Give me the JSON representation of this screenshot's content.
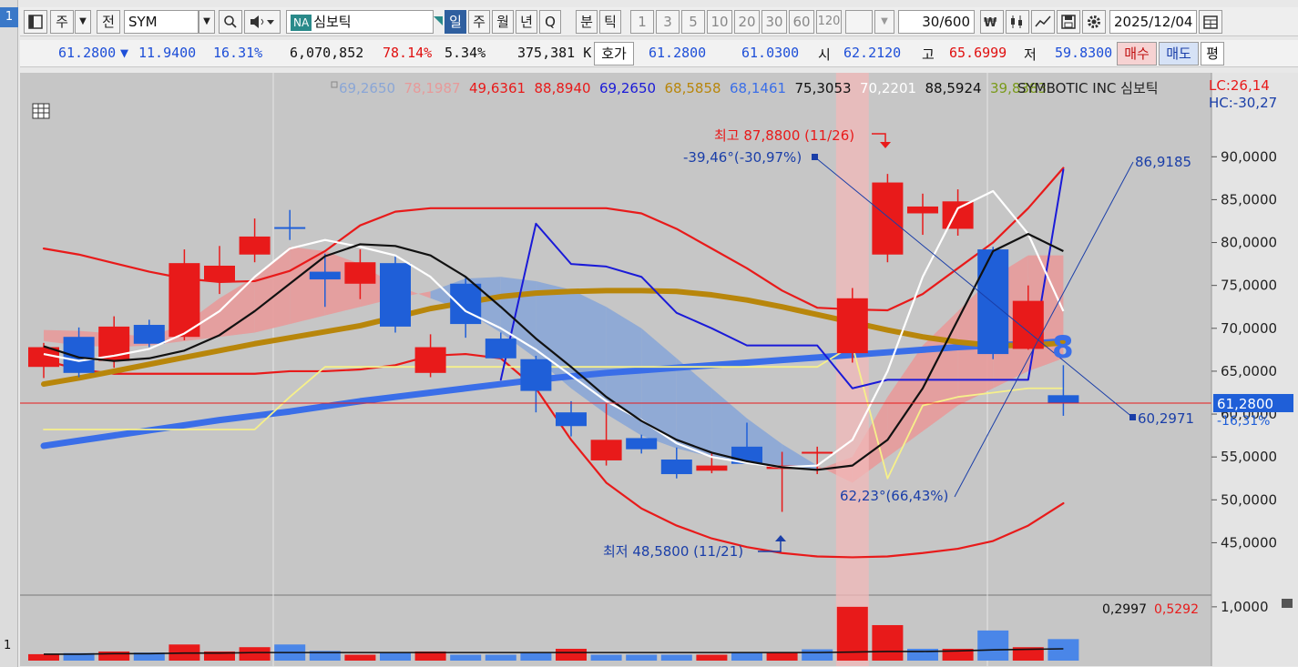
{
  "window": {
    "tab_number": "1",
    "bottom_number": "1"
  },
  "toolbar": {
    "period_label": "주",
    "prev_label": "전",
    "symbol": "SYM",
    "market_badge": "NA",
    "stock_name": "심보틱",
    "intervals": [
      "일",
      "주",
      "월",
      "년",
      "Q",
      "분",
      "틱"
    ],
    "active_interval": "일",
    "minute_options": [
      "1",
      "3",
      "5",
      "10",
      "20",
      "30",
      "60",
      "120"
    ],
    "count": "30",
    "count_max": "/600",
    "date": "2025/12/04",
    "icons": [
      "layout-icon",
      "search-icon",
      "speaker-icon",
      "ticker-icon",
      "candle-icon",
      "chart-line-icon",
      "save-icon",
      "gear-icon",
      "calendar-icon"
    ]
  },
  "quote": {
    "price": "61.2800",
    "direction": "▼",
    "change": "11.9400",
    "change_pct": "16.31%",
    "volume": "6,070,852",
    "vol_ratio": "78.14%",
    "turnover": "5.34%",
    "amount": "375,381 K",
    "bid_label": "호가",
    "bid": "61.2800",
    "ask": "61.0300",
    "open_label": "시",
    "open": "62.2120",
    "high_label": "고",
    "high": "65.6999",
    "low_label": "저",
    "low": "59.8300",
    "buy_label": "매수",
    "sell_label": "매도",
    "eval_label": "평"
  },
  "chart_data": {
    "type": "candlestick",
    "company": "SYMBOTIC INC",
    "name_kr": "심보틱",
    "legend_values": [
      {
        "text": "69,2650",
        "color": "#8aa6d6"
      },
      {
        "text": "78,1987",
        "color": "#e79a9a"
      },
      {
        "text": "49,6361",
        "color": "#e81a1a"
      },
      {
        "text": "88,8940",
        "color": "#e81a1a"
      },
      {
        "text": "69,2650",
        "color": "#1a1ad8"
      },
      {
        "text": "68,5858",
        "color": "#b8860b"
      },
      {
        "text": "68,1461",
        "color": "#3a6ee8"
      },
      {
        "text": "75,3053",
        "color": "#111111"
      },
      {
        "text": "70,2201",
        "color": "#ffffff"
      },
      {
        "text": "88,5924",
        "color": "#111111"
      },
      {
        "text": "39,8383",
        "color": "#7a9a1a"
      }
    ],
    "lc": "LC:26,14",
    "hc": "HC:-30,27",
    "y_ticks": [
      "90,0000",
      "85,0000",
      "80,0000",
      "75,0000",
      "70,0000",
      "65,0000",
      "60,0000",
      "55,0000",
      "50,0000",
      "45,0000"
    ],
    "ylim": [
      42.5,
      93.0
    ],
    "current_price_label": "61,2800",
    "current_change_label": "-16,31%",
    "current_price": 61.28,
    "candles": [
      {
        "o": 65.5,
        "h": 68.3,
        "l": 64.2,
        "c": 67.8
      },
      {
        "o": 69.0,
        "h": 70.1,
        "l": 64.3,
        "c": 64.8
      },
      {
        "o": 66.2,
        "h": 71.4,
        "l": 65.4,
        "c": 70.2
      },
      {
        "o": 70.4,
        "h": 71.0,
        "l": 67.8,
        "c": 68.2
      },
      {
        "o": 69.0,
        "h": 79.2,
        "l": 68.6,
        "c": 77.6
      },
      {
        "o": 75.5,
        "h": 79.6,
        "l": 74.0,
        "c": 77.3
      },
      {
        "o": 78.6,
        "h": 82.8,
        "l": 77.7,
        "c": 80.7
      },
      {
        "o": 81.8,
        "h": 83.8,
        "l": 80.3,
        "c": 81.6
      },
      {
        "o": 76.6,
        "h": 78.7,
        "l": 72.5,
        "c": 75.7
      },
      {
        "o": 75.2,
        "h": 79.2,
        "l": 73.4,
        "c": 77.7
      },
      {
        "o": 77.6,
        "h": 78.4,
        "l": 69.5,
        "c": 70.2
      },
      {
        "o": 64.8,
        "h": 69.3,
        "l": 64.3,
        "c": 67.8
      },
      {
        "o": 75.2,
        "h": 75.9,
        "l": 68.9,
        "c": 70.5
      },
      {
        "o": 68.8,
        "h": 69.5,
        "l": 66.4,
        "c": 66.5
      },
      {
        "o": 66.4,
        "h": 66.8,
        "l": 60.2,
        "c": 62.7
      },
      {
        "o": 60.2,
        "h": 61.5,
        "l": 57.4,
        "c": 58.6
      },
      {
        "o": 54.6,
        "h": 61.2,
        "l": 54.0,
        "c": 57.0
      },
      {
        "o": 57.2,
        "h": 57.6,
        "l": 55.4,
        "c": 55.9
      },
      {
        "o": 54.7,
        "h": 56.1,
        "l": 52.5,
        "c": 53.0
      },
      {
        "o": 53.4,
        "h": 55.6,
        "l": 53.1,
        "c": 54.0
      },
      {
        "o": 56.2,
        "h": 59.0,
        "l": 55.3,
        "c": 54.2
      },
      {
        "o": 53.6,
        "h": 55.6,
        "l": 48.6,
        "c": 54.0
      },
      {
        "o": 55.4,
        "h": 56.2,
        "l": 53.0,
        "c": 55.6
      },
      {
        "o": 67.1,
        "h": 74.7,
        "l": 66.0,
        "c": 73.5
      },
      {
        "o": 78.6,
        "h": 88.0,
        "l": 77.7,
        "c": 87.0
      },
      {
        "o": 83.4,
        "h": 85.7,
        "l": 80.9,
        "c": 84.2
      },
      {
        "o": 81.6,
        "h": 86.2,
        "l": 80.8,
        "c": 84.8
      },
      {
        "o": 79.2,
        "h": 79.5,
        "l": 66.4,
        "c": 67.0
      },
      {
        "o": 67.6,
        "h": 75.0,
        "l": 67.5,
        "c": 73.2
      },
      {
        "o": 62.2,
        "h": 65.7,
        "l": 59.8,
        "c": 61.3
      }
    ],
    "indicators": {
      "ma5_white": [
        67.0,
        66.2,
        66.8,
        67.6,
        69.4,
        72.0,
        76.0,
        79.3,
        80.3,
        79.5,
        78.5,
        76.0,
        72.0,
        70.0,
        67.5,
        64.5,
        61.5,
        59.3,
        56.6,
        55.0,
        54.3,
        53.8,
        54.0,
        57.0,
        65.0,
        76.0,
        84.0,
        86.0,
        81.0,
        72.0
      ],
      "ma10_black": [
        67.9,
        66.6,
        66.2,
        66.5,
        67.4,
        69.2,
        72.0,
        75.2,
        78.4,
        79.8,
        79.6,
        78.5,
        76.0,
        72.5,
        68.8,
        65.5,
        62.0,
        59.2,
        57.0,
        55.5,
        54.5,
        53.8,
        53.5,
        54.0,
        57.0,
        63.0,
        71.0,
        79.0,
        81.0,
        79.0
      ],
      "ma60_gold": [
        63.5,
        64.2,
        65.0,
        65.8,
        66.6,
        67.4,
        68.2,
        68.9,
        69.6,
        70.3,
        71.3,
        72.3,
        73.0,
        73.7,
        74.1,
        74.3,
        74.4,
        74.4,
        74.3,
        73.9,
        73.3,
        72.5,
        71.6,
        70.7,
        69.8,
        69.0,
        68.4,
        68.0,
        68.0,
        68.3
      ],
      "trend_blue": [
        56.3,
        56.9,
        57.5,
        58.1,
        58.7,
        59.3,
        59.8,
        60.3,
        60.9,
        61.5,
        62.0,
        62.5,
        63.0,
        63.5,
        64.0,
        64.4,
        64.8,
        65.1,
        65.4,
        65.7,
        66.0,
        66.3,
        66.6,
        66.9,
        67.2,
        67.5,
        67.8,
        68.0,
        68.2,
        68.5
      ],
      "env_upper_red": [
        79.3,
        78.6,
        77.6,
        76.6,
        75.8,
        75.4,
        75.5,
        76.7,
        79.0,
        82.0,
        83.6,
        84.0,
        84.0,
        84.0,
        84.0,
        84.0,
        84.0,
        83.4,
        81.6,
        79.3,
        77.0,
        74.4,
        72.4,
        72.2,
        72.1,
        74.0,
        77.0,
        80.0,
        84.0,
        88.7
      ],
      "env_lower_red": [
        66.3,
        65.2,
        64.7,
        64.7,
        64.7,
        64.7,
        64.7,
        65.0,
        65.0,
        65.2,
        65.7,
        66.8,
        67.0,
        66.5,
        63.0,
        57.0,
        52.0,
        49.0,
        47.0,
        45.5,
        44.5,
        43.8,
        43.4,
        43.3,
        43.4,
        43.8,
        44.3,
        45.2,
        47.0,
        49.6
      ],
      "line_blue": [
        null,
        null,
        null,
        null,
        null,
        null,
        null,
        null,
        null,
        null,
        null,
        null,
        null,
        64.0,
        82.2,
        77.5,
        77.2,
        76.0,
        71.8,
        70.0,
        68.0,
        68.0,
        68.0,
        63.0,
        64.0,
        64.0,
        64.0,
        64.0,
        64.0,
        88.5
      ],
      "line_yellow": [
        58.2,
        58.2,
        58.2,
        58.2,
        58.2,
        58.2,
        58.2,
        62.0,
        65.5,
        65.5,
        65.5,
        65.5,
        65.5,
        65.5,
        65.5,
        65.5,
        65.5,
        65.5,
        65.5,
        65.5,
        65.5,
        65.5,
        65.5,
        68.0,
        52.5,
        61.0,
        62.0,
        62.5,
        63.0,
        63.0
      ],
      "cloud_a": [
        69.8,
        69.7,
        69.4,
        69.0,
        70.5,
        73.5,
        76.0,
        79.5,
        79.0,
        77.5,
        75.0,
        73.5,
        72.0,
        69.5,
        66.5,
        63.0,
        60.0,
        57.5,
        56.0,
        55.0,
        54.5,
        54.0,
        53.5,
        55.0,
        62.0,
        68.0,
        72.0,
        76.0,
        78.5,
        78.5
      ],
      "cloud_b": [
        68.5,
        68.0,
        67.8,
        68.0,
        68.5,
        69.0,
        69.5,
        70.5,
        71.5,
        72.5,
        73.5,
        74.3,
        75.8,
        76.0,
        75.5,
        74.5,
        72.5,
        70.0,
        66.5,
        63.0,
        59.5,
        56.5,
        54.0,
        52.0,
        55.0,
        58.0,
        61.0,
        63.0,
        65.0,
        66.5
      ]
    },
    "volume": {
      "values": [
        0.12,
        0.14,
        0.17,
        0.15,
        0.3,
        0.17,
        0.25,
        0.3,
        0.18,
        0.11,
        0.16,
        0.17,
        0.11,
        0.11,
        0.14,
        0.22,
        0.11,
        0.11,
        0.11,
        0.11,
        0.15,
        0.15,
        0.21,
        1.0,
        0.66,
        0.22,
        0.22,
        0.56,
        0.25,
        0.4
      ],
      "up_down": [
        "u",
        "d",
        "u",
        "d",
        "u",
        "u",
        "u",
        "d",
        "d",
        "u",
        "d",
        "u",
        "d",
        "d",
        "d",
        "u",
        "d",
        "d",
        "d",
        "u",
        "d",
        "u",
        "d",
        "u",
        "u",
        "d",
        "u",
        "d",
        "u",
        "d"
      ],
      "avg_line": [
        0.12,
        0.12,
        0.13,
        0.13,
        0.14,
        0.14,
        0.15,
        0.15,
        0.15,
        0.15,
        0.15,
        0.15,
        0.15,
        0.15,
        0.15,
        0.15,
        0.15,
        0.15,
        0.15,
        0.15,
        0.15,
        0.15,
        0.15,
        0.16,
        0.17,
        0.17,
        0.18,
        0.2,
        0.21,
        0.22
      ],
      "labels": [
        "0,2997",
        "0,5292"
      ],
      "tick": "1,0000",
      "ylim": [
        0,
        1.15
      ]
    },
    "annotations": {
      "max_label": "최고 87,8800 (11/26)",
      "min_label": "최저 48,5800 (11/21)",
      "angle_down": "-39,46°(-30,97%)",
      "angle_up": "62,23°(66,43%)",
      "target_top": "86,9185",
      "target_bottom": "60,2971",
      "marker": "8"
    }
  }
}
